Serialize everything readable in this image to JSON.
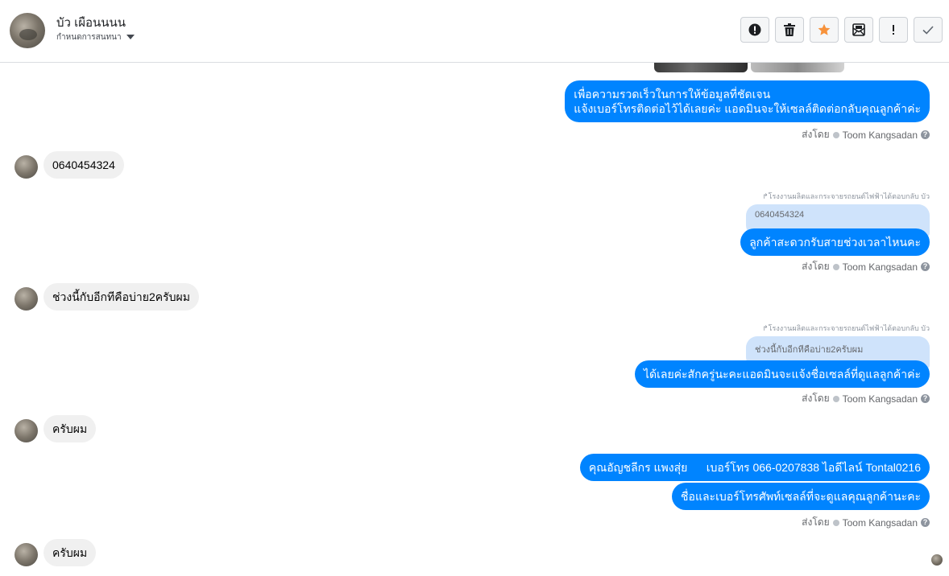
{
  "header": {
    "contact_name": "บัว เผือนนนน",
    "subtitle": "กำหนดการสนทนา",
    "toolbar": [
      {
        "name": "report-icon",
        "tooltip": ""
      },
      {
        "name": "trash-icon",
        "tooltip": ""
      },
      {
        "name": "star-icon",
        "tooltip": ""
      },
      {
        "name": "mark-unread-icon",
        "tooltip": ""
      },
      {
        "name": "exclamation-icon",
        "tooltip": ""
      },
      {
        "name": "checkmark-icon",
        "tooltip": ""
      }
    ]
  },
  "colors": {
    "outgoing_bubble": "#0084ff",
    "incoming_bubble": "#f0f0f0",
    "quoted_bubble": "#cfe3fb",
    "star": "#f7923b"
  },
  "messages": {
    "m1_line1": "เพื่อความรวดเร็วในการให้ข้อมูลที่ชัดเจน",
    "m1_line2": "แจ้งเบอร์โทรติดต่อไว้ได้เลยค่ะ แอดมินจะให้เซลล์ติดต่อกลับคุณลูกค้าค่ะ",
    "m2": "0640454324",
    "m3_reply_note": "โรงงานผลิตและกระจายรถยนต์ไฟฟ้าได้ตอบกลับ บัว",
    "m3_quote": "0640454324",
    "m3": "ลูกค้าสะดวกรับสายช่วงเวลาไหนคะ",
    "m4": "ช่วงนี้กับอีกทีคือบ่าย2ครับผม",
    "m5_reply_note": "โรงงานผลิตและกระจายรถยนต์ไฟฟ้าได้ตอบกลับ บัว",
    "m5_quote": "ช่วงนี้กับอีกทีคือบ่าย2ครับผม",
    "m5": "ได้เลยค่ะสักครู่นะคะแอดมินจะแจ้งชื่อเซลล์ที่ดูแลลูกค้าค่ะ",
    "m6": "ครับผม",
    "m7": "คุณอัญชลีกร แพงสุ่ย      เบอร์โทร 066-0207838 ไอดีไลน์ Tontal0216",
    "m8": "ชื่อและเบอร์โทรศัพท์เซลล์ที่จะดูแลคุณลูกค้านะคะ",
    "m9": "ครับผม"
  },
  "sent_by": {
    "label": "ส่งโดย",
    "agent": "Toom Kangsadan"
  }
}
